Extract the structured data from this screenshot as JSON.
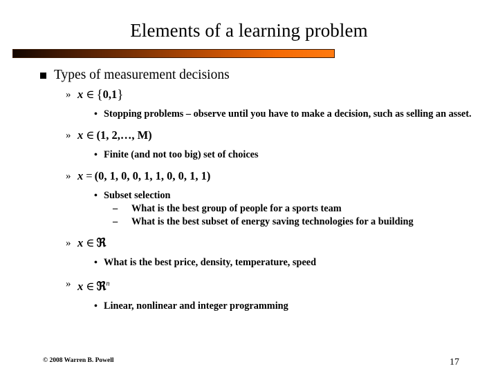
{
  "slide": {
    "title": "Elements of a learning problem",
    "accent_color_start": "#130600",
    "accent_color_end": "#ff7a10",
    "background_color": "#ffffff",
    "text_color": "#000000"
  },
  "bullets": {
    "level1": "Types of measurement decisions",
    "square_marker": "square-bullet",
    "chevron_marker": "»",
    "dot_marker": "•",
    "dash_marker": "–"
  },
  "items": [
    {
      "math": {
        "var": "x",
        "op": "∈",
        "open": "{",
        "body": "0,1",
        "close": "}",
        "sup": ""
      },
      "subs": [
        "Stopping problems – observe until you have to make a decision, such as selling an asset."
      ],
      "subsubs": []
    },
    {
      "math": {
        "var": "x",
        "op": "∈",
        "open": "(",
        "body": "1, 2,…, M",
        "close": ")",
        "sup": ""
      },
      "subs": [
        "Finite (and not too big) set of choices"
      ],
      "subsubs": []
    },
    {
      "math": {
        "var": "x",
        "op": "=",
        "open": "(",
        "body": "0, 1, 0, 0, 1, 1, 0, 0, 1, 1",
        "close": ")",
        "sup": ""
      },
      "subs": [
        "Subset selection"
      ],
      "subsubs": [
        "What is the best group of people for a sports team",
        "What is the best subset of energy saving technologies for a building"
      ]
    },
    {
      "math": {
        "var": "x",
        "op": "∈",
        "open": "",
        "body": "ℜ",
        "close": "",
        "sup": ""
      },
      "subs": [
        "What is the best price, density, temperature, speed"
      ],
      "subsubs": []
    },
    {
      "math": {
        "var": "x",
        "op": "∈",
        "open": "",
        "body": "ℜ",
        "close": "",
        "sup": "n"
      },
      "subs": [
        "Linear, nonlinear and integer programming"
      ],
      "subsubs": []
    }
  ],
  "footer": {
    "copyright": "© 2008 Warren B. Powell",
    "page_number": "17"
  }
}
